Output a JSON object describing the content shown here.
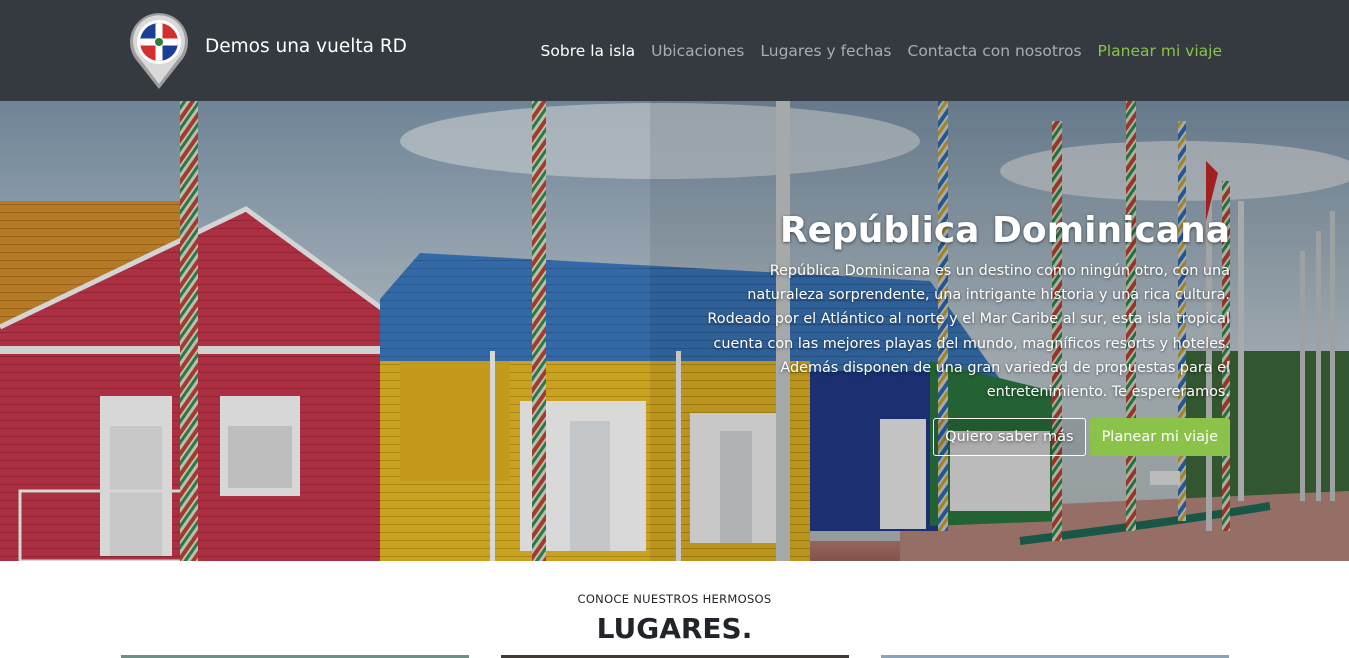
{
  "brand": {
    "name": "Demos una vuelta RD",
    "logo_icon": "dominican-flag-map-pin-icon"
  },
  "nav": [
    {
      "label": "Sobre la isla",
      "state": "active"
    },
    {
      "label": "Ubicaciones",
      "state": "default"
    },
    {
      "label": "Lugares y fechas",
      "state": "default"
    },
    {
      "label": "Contacta con nosotros",
      "state": "default"
    },
    {
      "label": "Planear mi viaje",
      "state": "accent"
    }
  ],
  "hero": {
    "title": "República Dominicana",
    "text": "República Dominicana es un destino como ningún otro, con una naturaleza sorprendente, una intrigante historia y una rica cultura. Rodeado por el Atlántico al norte y el Mar Caribe al sur, esta isla tropical cuenta con las mejores playas del mundo, magníficos resorts y hoteles. Además disponen de una gran variedad de propuestas para el entretenimiento. Te espereramos.",
    "primary_button": "Quiero saber más",
    "secondary_button": "Planear mi viaje",
    "background_image": "colorful-wooden-houses-with-flag-poles"
  },
  "section": {
    "subtitle": "CONOCE NUESTROS HERMOSOS",
    "title": "LUGARES."
  },
  "colors": {
    "navbar": "#343a40",
    "accent": "#8bc34a",
    "nav_inactive": "#a8adb2",
    "text_white": "#ffffff"
  }
}
